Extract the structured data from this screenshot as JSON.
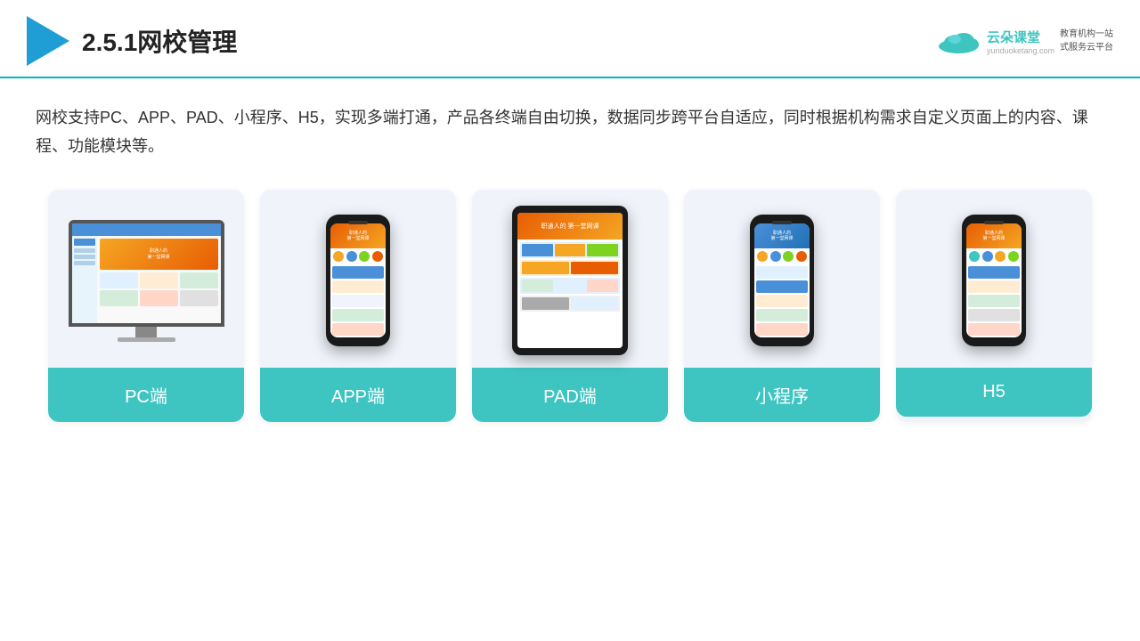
{
  "header": {
    "title": "2.5.1网校管理",
    "brand": {
      "name": "云朵课堂",
      "url": "yunduoketang.com",
      "slogan": "教育机构一站\n式服务云平台"
    }
  },
  "description": {
    "text": "网校支持PC、APP、PAD、小程序、H5，实现多端打通，产品各终端自由切换，数据同步跨平台自适应，同时根据机构需求自定义页面上的内容、课程、功能模块等。"
  },
  "cards": [
    {
      "id": "pc",
      "label": "PC端",
      "device_type": "pc"
    },
    {
      "id": "app",
      "label": "APP端",
      "device_type": "phone"
    },
    {
      "id": "pad",
      "label": "PAD端",
      "device_type": "pad"
    },
    {
      "id": "mini",
      "label": "小程序",
      "device_type": "phone_sm"
    },
    {
      "id": "h5",
      "label": "H5",
      "device_type": "phone_sm"
    }
  ],
  "colors": {
    "accent": "#3ec5c2",
    "blue": "#4a90d9",
    "orange": "#f5a623",
    "green": "#7ed321",
    "header_line": "#00b8c8"
  }
}
